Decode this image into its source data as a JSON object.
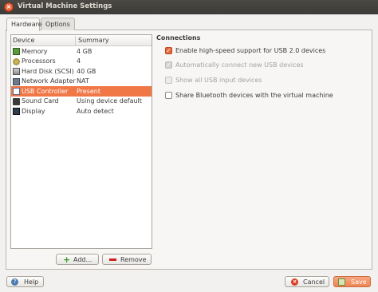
{
  "window": {
    "title": "Virtual Machine Settings",
    "close_glyph": "×"
  },
  "tabs": [
    {
      "label": "Hardware",
      "active": true
    },
    {
      "label": "Options",
      "active": false
    }
  ],
  "device_list": {
    "columns": [
      "Device",
      "Summary"
    ],
    "rows": [
      {
        "device": "Memory",
        "summary": "4 GB",
        "icon": "memory-icon"
      },
      {
        "device": "Processors",
        "summary": "4",
        "icon": "processor-icon"
      },
      {
        "device": "Hard Disk (SCSI)",
        "summary": "40 GB",
        "icon": "hard-disk-icon"
      },
      {
        "device": "Network Adapter",
        "summary": "NAT",
        "icon": "network-adapter-icon"
      },
      {
        "device": "USB Controller",
        "summary": "Present",
        "icon": "usb-icon",
        "selected": true
      },
      {
        "device": "Sound Card",
        "summary": "Using device default",
        "icon": "sound-card-icon"
      },
      {
        "device": "Display",
        "summary": "Auto detect",
        "icon": "display-icon"
      }
    ]
  },
  "list_buttons": {
    "add": "Add...",
    "remove": "Remove"
  },
  "connections": {
    "title": "Connections",
    "options": [
      {
        "label": "Enable high-speed support for USB 2.0 devices",
        "checked": true,
        "enabled": true
      },
      {
        "label": "Automatically connect new USB devices",
        "checked": true,
        "enabled": false
      },
      {
        "label": "Show all USB input devices",
        "checked": false,
        "enabled": false
      },
      {
        "label": "Share Bluetooth devices with the virtual machine",
        "checked": false,
        "enabled": true
      }
    ]
  },
  "footer": {
    "help": "Help",
    "cancel": "Cancel",
    "save": "Save"
  },
  "glyphs": {
    "check": "✓",
    "help": "?",
    "cancel": "×",
    "plus": "+"
  },
  "colors": {
    "accent": "#f07746",
    "titlebar": "#3c3b37"
  }
}
